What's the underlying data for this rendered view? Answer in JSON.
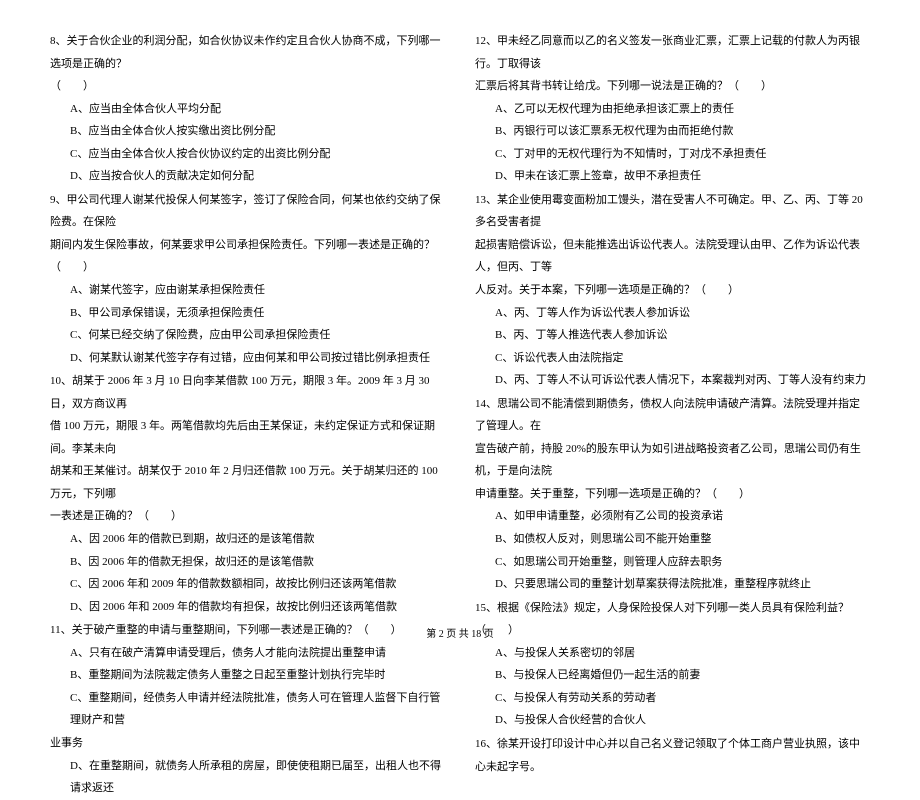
{
  "left": {
    "q8": {
      "stem": "8、关于合伙企业的利润分配，如合伙协议未作约定且合伙人协商不成，下列哪一选项是正确的？",
      "paren": "（　　）",
      "a": "A、应当由全体合伙人平均分配",
      "b": "B、应当由全体合伙人按实缴出资比例分配",
      "c": "C、应当由全体合伙人按合伙协议约定的出资比例分配",
      "d": "D、应当按合伙人的贡献决定如何分配"
    },
    "q9": {
      "stem1": "9、甲公司代理人谢某代投保人何某签字，签订了保险合同，何某也依约交纳了保险费。在保险",
      "stem2": "期间内发生保险事故，何某要求甲公司承担保险责任。下列哪一表述是正确的？（　　）",
      "a": "A、谢某代签字，应由谢某承担保险责任",
      "b": "B、甲公司承保错误，无须承担保险责任",
      "c": "C、何某已经交纳了保险费，应由甲公司承担保险责任",
      "d": "D、何某默认谢某代签字存有过错，应由何某和甲公司按过错比例承担责任"
    },
    "q10": {
      "stem1": "10、胡某于 2006 年 3 月 10 日向李某借款 100 万元，期限 3 年。2009 年 3 月 30 日，双方商议再",
      "stem2": "借 100 万元，期限 3 年。两笔借款均先后由王某保证，未约定保证方式和保证期间。李某未向",
      "stem3": "胡某和王某催讨。胡某仅于 2010 年 2 月归还借款 100 万元。关于胡某归还的 100 万元，下列哪",
      "stem4": "一表述是正确的？（　　）",
      "a": "A、因 2006 年的借款已到期，故归还的是该笔借款",
      "b": "B、因 2006 年的借款无担保，故归还的是该笔借款",
      "c": "C、因 2006 年和 2009 年的借款数额相同，故按比例归还该两笔借款",
      "d": "D、因 2006 年和 2009 年的借款均有担保，故按比例归还该两笔借款"
    },
    "q11": {
      "stem": "11、关于破产重整的申请与重整期间，下列哪一表述是正确的？（　　）",
      "a": "A、只有在破产清算申请受理后，债务人才能向法院提出重整申请",
      "b": "B、重整期间为法院裁定债务人重整之日起至重整计划执行完毕时",
      "c1": "C、重整期间，经债务人申请并经法院批准，债务人可在管理人监督下自行管理财产和营",
      "c2": "业事务",
      "d": "D、在重整期间，就债务人所承租的房屋，即使使租期已届至，出租人也不得请求返还"
    }
  },
  "right": {
    "q12": {
      "stem1": "12、甲未经乙同意而以乙的名义签发一张商业汇票，汇票上记载的付款人为丙银行。丁取得该",
      "stem2": "汇票后将其背书转让给戊。下列哪一说法是正确的？（　　）",
      "a": "A、乙可以无权代理为由拒绝承担该汇票上的责任",
      "b": "B、丙银行可以该汇票系无权代理为由而拒绝付款",
      "c": "C、丁对甲的无权代理行为不知情时，丁对戊不承担责任",
      "d": "D、甲未在该汇票上签章，故甲不承担责任"
    },
    "q13": {
      "stem1": "13、某企业使用霉变面粉加工馒头，潜在受害人不可确定。甲、乙、丙、丁等 20 多名受害者提",
      "stem2": "起损害赔偿诉讼，但未能推选出诉讼代表人。法院受理认由甲、乙作为诉讼代表人，但丙、丁等",
      "stem3": "人反对。关于本案，下列哪一选项是正确的？（　　）",
      "a": "A、丙、丁等人作为诉讼代表人参加诉讼",
      "b": "B、丙、丁等人推选代表人参加诉讼",
      "c": "C、诉讼代表人由法院指定",
      "d": "D、丙、丁等人不认可诉讼代表人情况下，本案裁判对丙、丁等人没有约束力"
    },
    "q14": {
      "stem1": "14、思瑞公司不能清偿到期债务，债权人向法院申请破产清算。法院受理并指定了管理人。在",
      "stem2": "宣告破产前，持股 20%的股东甲认为如引进战略投资者乙公司，思瑞公司仍有生机，于是向法院",
      "stem3": "申请重整。关于重整，下列哪一选项是正确的？（　　）",
      "a": "A、如甲申请重整，必须附有乙公司的投资承诺",
      "b": "B、如债权人反对，则思瑞公司不能开始重整",
      "c": "C、如思瑞公司开始重整，则管理人应辞去职务",
      "d": "D、只要思瑞公司的重整计划草案获得法院批准，重整程序就终止"
    },
    "q15": {
      "stem": "15、根据《保险法》规定，人身保险投保人对下列哪一类人员具有保险利益？（　　）",
      "a": "A、与投保人关系密切的邻居",
      "b": "B、与投保人已经离婚但仍一起生活的前妻",
      "c": "C、与投保人有劳动关系的劳动者",
      "d": "D、与投保人合伙经营的合伙人"
    },
    "q16": {
      "stem": "16、徐某开设打印设计中心并以自己名义登记领取了个体工商户营业执照，该中心未起字号。"
    }
  },
  "footer": "第 2 页 共 18 页"
}
